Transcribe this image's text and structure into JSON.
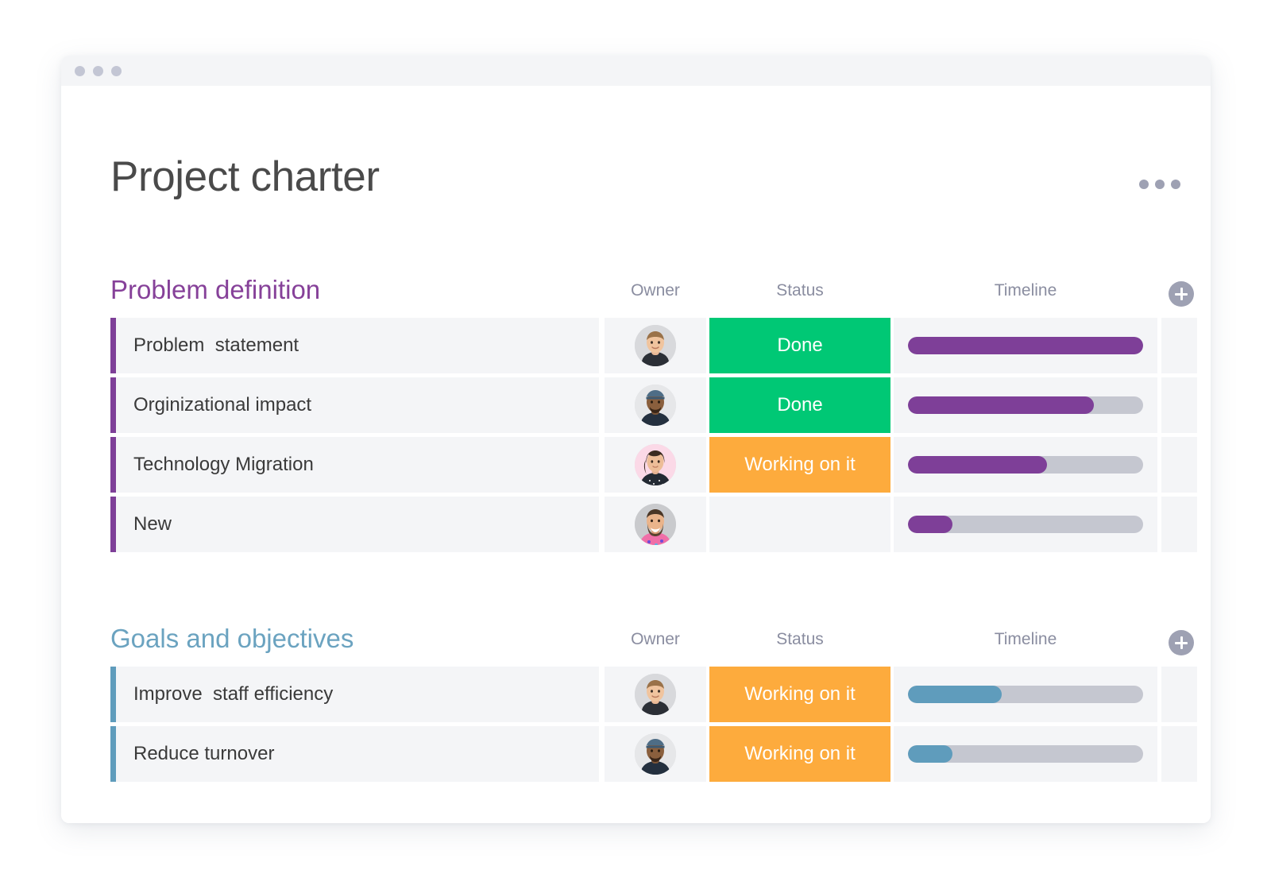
{
  "window": {
    "title_bar_dots": 3
  },
  "header": {
    "title": "Project charter",
    "menu_icon": "kebab-menu-icon"
  },
  "columns": {
    "owner": "Owner",
    "status": "Status",
    "timeline": "Timeline",
    "add": "add-column-icon"
  },
  "colors": {
    "purple": "#7e3f98",
    "purple_title": "#864199",
    "blue": "#5f9cbc",
    "blue_title": "#6ba3c0",
    "done_green": "#00c875",
    "working_orange": "#fdab3d",
    "track_gray": "#c5c7d0",
    "cell_bg": "#f4f5f7"
  },
  "groups": [
    {
      "title": "Problem definition",
      "accent": "purple",
      "rows": [
        {
          "name": "Problem  statement",
          "owner": "avatar-man-blond",
          "status": {
            "label": "Done",
            "color": "#00c875"
          },
          "timeline": {
            "percent": 100,
            "color": "purple"
          }
        },
        {
          "name": "Orginizational impact",
          "owner": "avatar-man-cap",
          "status": {
            "label": "Done",
            "color": "#00c875"
          },
          "timeline": {
            "percent": 79,
            "color": "purple"
          }
        },
        {
          "name": "Technology Migration",
          "owner": "avatar-woman-pink",
          "status": {
            "label": "Working on it",
            "color": "#fdab3d"
          },
          "timeline": {
            "percent": 59,
            "color": "purple"
          }
        },
        {
          "name": "New",
          "owner": "avatar-man-beard",
          "status": {
            "label": "",
            "color": "#f4f5f7"
          },
          "timeline": {
            "percent": 19,
            "color": "purple"
          }
        }
      ]
    },
    {
      "title": "Goals and objectives",
      "accent": "blue",
      "rows": [
        {
          "name": "Improve  staff efficiency",
          "owner": "avatar-man-blond",
          "status": {
            "label": "Working on it",
            "color": "#fdab3d"
          },
          "timeline": {
            "percent": 40,
            "color": "blue"
          }
        },
        {
          "name": "Reduce turnover",
          "owner": "avatar-man-cap",
          "status": {
            "label": "Working on it",
            "color": "#fdab3d"
          },
          "timeline": {
            "percent": 19,
            "color": "blue"
          }
        }
      ]
    }
  ]
}
